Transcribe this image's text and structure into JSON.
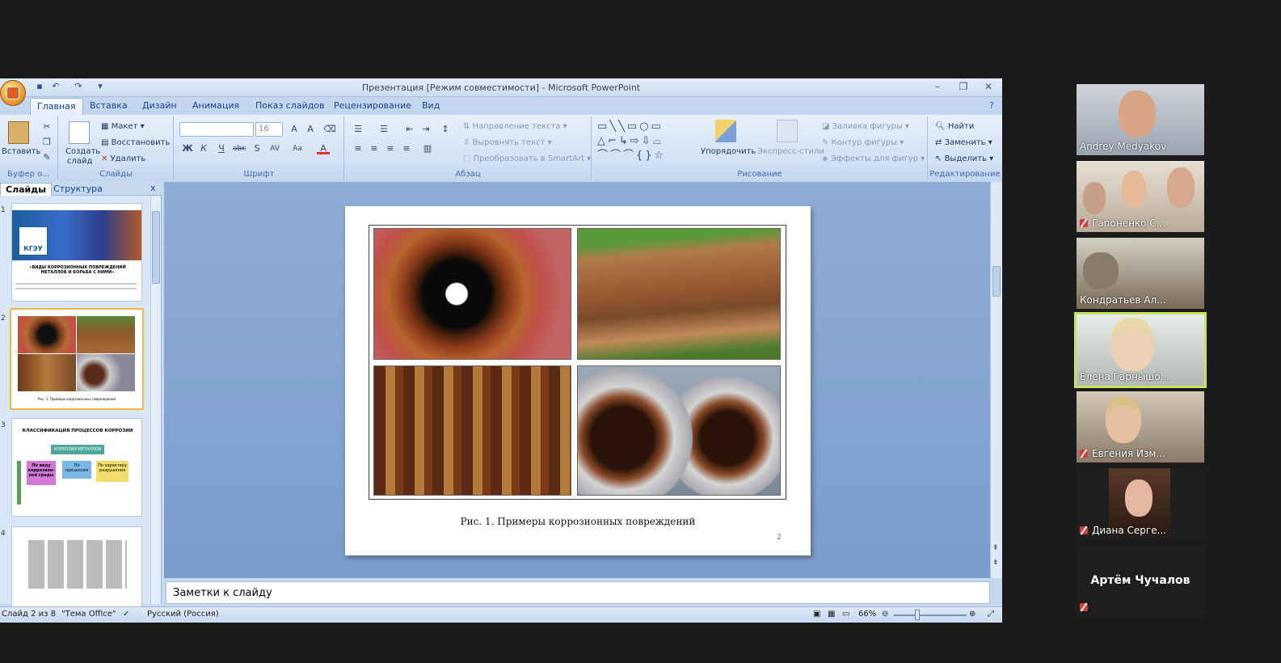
{
  "window": {
    "title": "Презентация [Режим совместимости] - Microsoft PowerPoint"
  },
  "tabs": [
    "Главная",
    "Вставка",
    "Дизайн",
    "Анимация",
    "Показ слайдов",
    "Рецензирование",
    "Вид"
  ],
  "ribbon": {
    "clipboard": {
      "paste": "Вставить",
      "label": "Буфер о..."
    },
    "slides": {
      "create": "Создать",
      "create2": "слайд",
      "layout": "Макет",
      "restore": "Восстановить",
      "delete": "Удалить",
      "label": "Слайды"
    },
    "font": {
      "size": "16",
      "label": "Шрифт"
    },
    "paragraph": {
      "direction": "Направление текста",
      "align": "Выровнять текст",
      "smartart": "Преобразовать в SmartArt",
      "label": "Абзац"
    },
    "drawing": {
      "arrange": "Упорядочить",
      "styles": "Экспресс-стили",
      "fill": "Заливка фигуры",
      "outline": "Контур фигуры",
      "effects": "Эффекты для фигур",
      "label": "Рисование"
    },
    "editing": {
      "find": "Найти",
      "replace": "Заменить",
      "select": "Выделить",
      "label": "Редактирование"
    }
  },
  "leftpane": {
    "tab_slides": "Слайды",
    "tab_outline": "Структура",
    "close": "x",
    "slide1": {
      "num": "1",
      "logo": "КГЭУ",
      "title": "«ВИДЫ КОРРОЗИОННЫХ ПОВРЕЖДЕНИЙ МЕТАЛЛОВ И БОРЬБА С НИМИ»"
    },
    "slide2": {
      "num": "2",
      "cap": "Рис. 1. Примеры коррозионных повреждений"
    },
    "slide3": {
      "num": "3",
      "title": "КЛАССИФИКАЦИЯ ПРОЦЕССОВ КОРРОЗИИ",
      "box": "КОРРОЗИЯ МЕТАЛЛОВ",
      "c1": "По виду коррозион-ной среды",
      "c2": "По процессам",
      "c3": "По характеру разрушения"
    },
    "slide4": {
      "num": "4"
    }
  },
  "slide": {
    "caption": "Рис. 1. Примеры коррозионных повреждений",
    "page": "2"
  },
  "notes": {
    "placeholder": "Заметки к слайду"
  },
  "status": {
    "slide": "Слайд 2 из 8",
    "theme": "\"Тема Office\"",
    "lang": "Русский (Россия)",
    "zoom": "66%"
  },
  "participants": [
    {
      "name": "Andrey Medyakov",
      "muted": false
    },
    {
      "name": "Гапоненко С...",
      "muted": true
    },
    {
      "name": "Кондратьев Ал...",
      "muted": false
    },
    {
      "name": "Елена Гарнышо...",
      "muted": false
    },
    {
      "name": "Евгения Изм...",
      "muted": true
    },
    {
      "name": "Диана Серге...",
      "muted": true
    },
    {
      "name": "Артём Чучалов",
      "muted": true
    }
  ],
  "colors": {
    "accent": "#15428b",
    "ribbon": "#d2e1f4",
    "slide_bg": "#7b9ccb",
    "active_speaker": "#c8e35a"
  }
}
